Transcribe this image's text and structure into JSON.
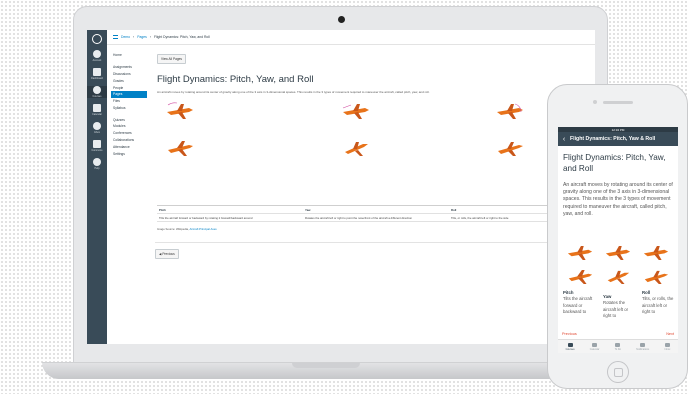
{
  "laptop": {
    "global_nav": [
      {
        "label": "Account",
        "active": false
      },
      {
        "label": "Dashboard",
        "active": false
      },
      {
        "label": "Courses",
        "active": true
      },
      {
        "label": "Calendar",
        "active": false
      },
      {
        "label": "Inbox",
        "active": false
      },
      {
        "label": "Commons",
        "active": false
      },
      {
        "label": "Help",
        "active": false
      }
    ],
    "breadcrumb": [
      "Demo",
      "Pages",
      "Flight Dynamics: Pitch, Yaw, and Roll"
    ],
    "course_nav": [
      {
        "label": "Home",
        "state": "normal"
      },
      {
        "label": "",
        "state": "sep"
      },
      {
        "label": "Assignments",
        "state": "normal"
      },
      {
        "label": "Discussions",
        "state": "normal"
      },
      {
        "label": "Grades",
        "state": "normal"
      },
      {
        "label": "People",
        "state": "normal"
      },
      {
        "label": "Pages",
        "state": "active"
      },
      {
        "label": "Files",
        "state": "normal"
      },
      {
        "label": "Syllabus",
        "state": "normal"
      },
      {
        "label": "",
        "state": "sep"
      },
      {
        "label": "Quizzes",
        "state": "normal"
      },
      {
        "label": "Modules",
        "state": "normal"
      },
      {
        "label": "Conferences",
        "state": "normal"
      },
      {
        "label": "Collaborations",
        "state": "normal"
      },
      {
        "label": "Attendance",
        "state": "normal"
      },
      {
        "label": "Settings",
        "state": "normal"
      }
    ],
    "edit_button": "View All Pages",
    "page_title": "Flight Dynamics: Pitch, Yaw, and Roll",
    "intro": "An aircraft moves by rotating around its center of gravity along one of the 3 axis in 3-dimensional spaces. This results in the 3 types of movement required to maneuver the aircraft, called pitch, yaw, and roll.",
    "table": {
      "headers": [
        "Pitch",
        "Yaw",
        "Roll"
      ],
      "cells": [
        "Tilts the aircraft forward or backward by rotating it forward/backward around",
        "Rotates the aircraft left or right to point the nose/front of the aircraft a different direction",
        "Tilts, or rolls, the aircraft left or right to the side"
      ]
    },
    "footnote_prefix": "Image Source: Wikipedia, ",
    "footnote_link": "Aircraft Principal Axes",
    "prev_button": "◀ Previous"
  },
  "phone": {
    "status_time": "12:34 PM",
    "back": "‹",
    "header_title": "Flight Dynamics: Pitch, Yaw & Roll",
    "title": "Flight Dynamics: Pitch, Yaw, and Roll",
    "intro": "An aircraft moves by rotating around its center of gravity along one of the 3 axis in 3-dimensional spaces. This results in the 3 types of movement required to maneuver the aircraft, called pitch, yaw, and roll.",
    "columns": [
      {
        "header": "Pitch",
        "text": "Tilts the aircraft forward or backward to"
      },
      {
        "header": "Yaw",
        "text": "Rotates the aircraft left or right to"
      },
      {
        "header": "Roll",
        "text": "Tilts, or rolls, the aircraft left or right to"
      }
    ],
    "prev_link": "Previous",
    "next_link": "Next",
    "tabs": [
      {
        "label": "Courses",
        "active": true
      },
      {
        "label": "Calendar",
        "active": false
      },
      {
        "label": "To Do",
        "active": false
      },
      {
        "label": "Notifications",
        "active": false
      },
      {
        "label": "Inbox",
        "active": false
      }
    ]
  },
  "colors": {
    "nav_dark": "#394b58",
    "link_blue": "#0081c6",
    "plane_orange": "#e8731a",
    "mobile_red": "#e0462f"
  }
}
